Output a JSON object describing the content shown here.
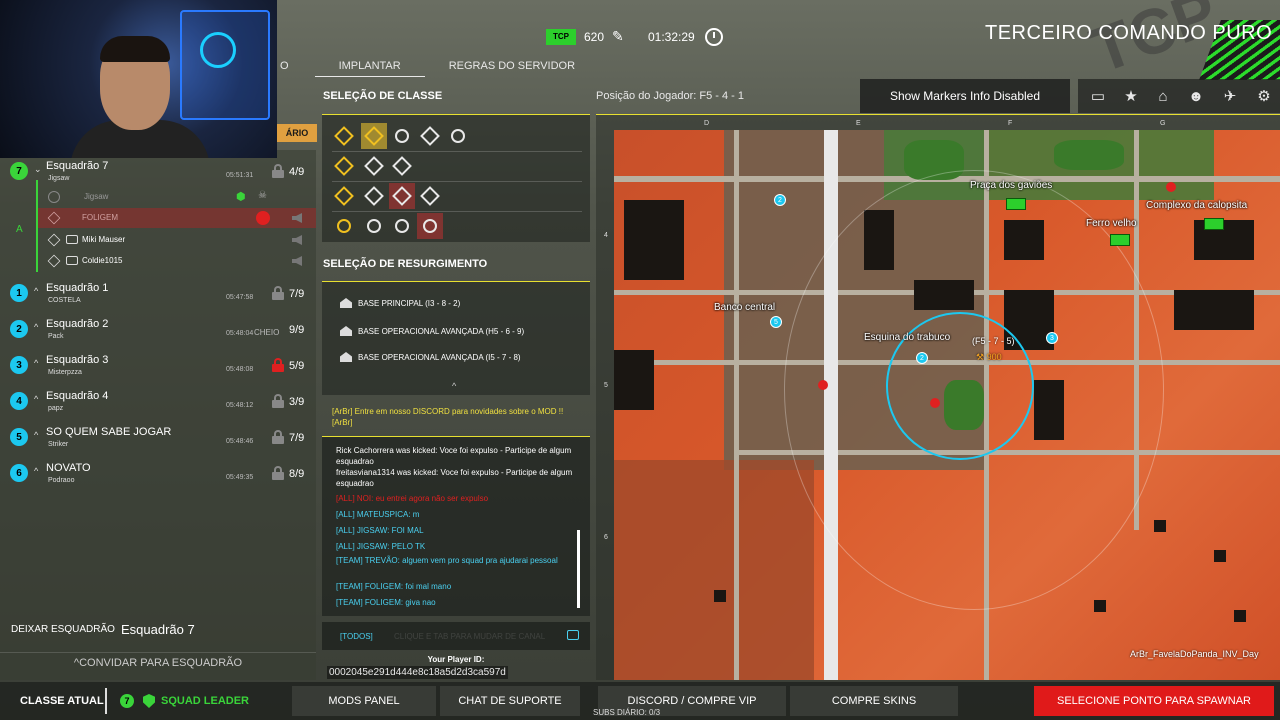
{
  "header": {
    "faction": "TERCEIRO COMANDO PURO",
    "tcp_logo_text": "TCP",
    "tickets": "620",
    "timer": "01:32:29",
    "tabs": [
      {
        "label": "O"
      },
      {
        "label": "IMPLANTAR"
      },
      {
        "label": "REGRAS DO SERVIDOR"
      }
    ]
  },
  "squad_panel": {
    "header_tab_label": "ÁRIO",
    "my_squad_letter": "A",
    "squads": [
      {
        "num": "7",
        "name": "Esquadrão 7",
        "leader": "Jigsaw",
        "time": "05:51:31",
        "status": "",
        "count": "4/9",
        "lock": "gray",
        "color": "green"
      },
      {
        "num": "1",
        "name": "Esquadrão 1",
        "leader": "COSTELA",
        "time": "05:47:58",
        "status": "",
        "count": "7/9",
        "lock": "gray",
        "color": "cyan"
      },
      {
        "num": "2",
        "name": "Esquadrão 2",
        "leader": "Pack",
        "time": "05:48:04",
        "status": "CHEIO",
        "count": "9/9",
        "lock": "none",
        "color": "cyan"
      },
      {
        "num": "3",
        "name": "Esquadrão 3",
        "leader": "Misterpzza",
        "time": "05:48:08",
        "status": "",
        "count": "5/9",
        "lock": "red",
        "color": "cyan"
      },
      {
        "num": "4",
        "name": "Esquadrão 4",
        "leader": "papz",
        "time": "05:48:12",
        "status": "",
        "count": "3/9",
        "lock": "gray",
        "color": "cyan"
      },
      {
        "num": "5",
        "name": "SO QUEM SABE JOGAR",
        "leader": "Striker",
        "time": "05:48:46",
        "status": "",
        "count": "7/9",
        "lock": "gray",
        "color": "cyan"
      },
      {
        "num": "6",
        "name": "NOVATO",
        "leader": "Podraoo",
        "time": "05:49:35",
        "status": "",
        "count": "8/9",
        "lock": "gray",
        "color": "cyan"
      }
    ],
    "members": [
      {
        "name": "Jigsaw",
        "state": "faded"
      },
      {
        "name": "FOLIGEM",
        "state": "kicked"
      },
      {
        "name": "Miki Mauser",
        "state": "normal"
      },
      {
        "name": "Coldie1015",
        "state": "normal"
      }
    ],
    "leave_label": "DEIXAR ESQUADRÃO",
    "leave_squad_name": "Esquadrão 7",
    "invite_label": "CONVIDAR PARA ESQUADRÃO"
  },
  "class_selection": {
    "title": "SELEÇÃO DE CLASSE"
  },
  "respawn_selection": {
    "title": "SELEÇÃO DE RESURGIMENTO",
    "items": [
      "BASE PRINCIPAL (I3 - 8 - 2)",
      "BASE OPERACIONAL AVANÇADA (H5 - 6 - 9)",
      "BASE OPERACIONAL AVANÇADA (I5 - 7 - 8)"
    ]
  },
  "chat": {
    "discord_msg": "[ArBr] Entre em nosso DISCORD para novidades sobre o MOD !! [ArBr]",
    "lines": [
      {
        "text": " Rick Cachorrera was kicked: Voce foi expulso - Participe de algum esquadrao",
        "type": "system"
      },
      {
        "text": " freitasviana1314 was kicked: Voce foi expulso - Participe de algum esquadrao",
        "type": "system"
      },
      {
        "text": "[ALL] NOI: eu entrei agora não ser expulso",
        "type": "red"
      },
      {
        "text": "[ALL]  MATEUSPICA: m",
        "type": "all"
      },
      {
        "text": "[ALL]  JIGSAW: FOI MAL",
        "type": "all"
      },
      {
        "text": "[ALL]  JIGSAW: PELO TK",
        "type": "all"
      },
      {
        "text": "[TEAM]  TREVÃO: alguem vem pro squad pra ajudarai pessoal",
        "type": "team"
      },
      {
        "text": "[TEAM]  FOLIGEM: foi mal mano",
        "type": "team"
      },
      {
        "text": "[TEAM]  FOLIGEM: giva nao",
        "type": "team"
      }
    ],
    "channel": "[TODOS]",
    "placeholder": "CLIQUE E TAB PARA MUDAR DE CANAL",
    "player_id_label": "Your Player ID:",
    "player_id": "0002045e291d444e8c18a5d2d3ca597d"
  },
  "map_header": {
    "position_label": "Posição do Jogador: F5 - 4 - 1",
    "markers_button": "Show Markers Info Disabled"
  },
  "map": {
    "col_labels": [
      "D",
      "E",
      "F",
      "G"
    ],
    "row_labels": [
      "4",
      "5",
      "6"
    ],
    "places": [
      "Praça dos gaviões",
      "Complexo da calopsita",
      "Ferro velho",
      "Banco central",
      "Esquina do trabuco"
    ],
    "cursor_coords": "(F5 - 7 - 5)",
    "cursor_distance": "900",
    "map_name": "ArBr_FavelaDoPanda_INV_Day",
    "pin_numbers": [
      "5",
      "2",
      "3",
      "2"
    ]
  },
  "bottom_bar": {
    "current_class_label": "CLASSE ATUAL",
    "squad_num": "7",
    "role": "SQUAD LEADER",
    "buttons": [
      "MODS PANEL",
      "CHAT DE SUPORTE",
      "DISCORD  /  COMPRE VIP",
      "COMPRE SKINS"
    ],
    "spawn_button": "SELECIONE PONTO PARA SPAWNAR",
    "subs": "SUBS DIÁRIO: 0/3"
  },
  "colors": {
    "accent_yellow": "#e8e030",
    "squad_cyan": "#1cc8f0",
    "squad_green": "#3ad43a",
    "spawn_red": "#e01a1a",
    "map_orange": "#d8582a"
  }
}
